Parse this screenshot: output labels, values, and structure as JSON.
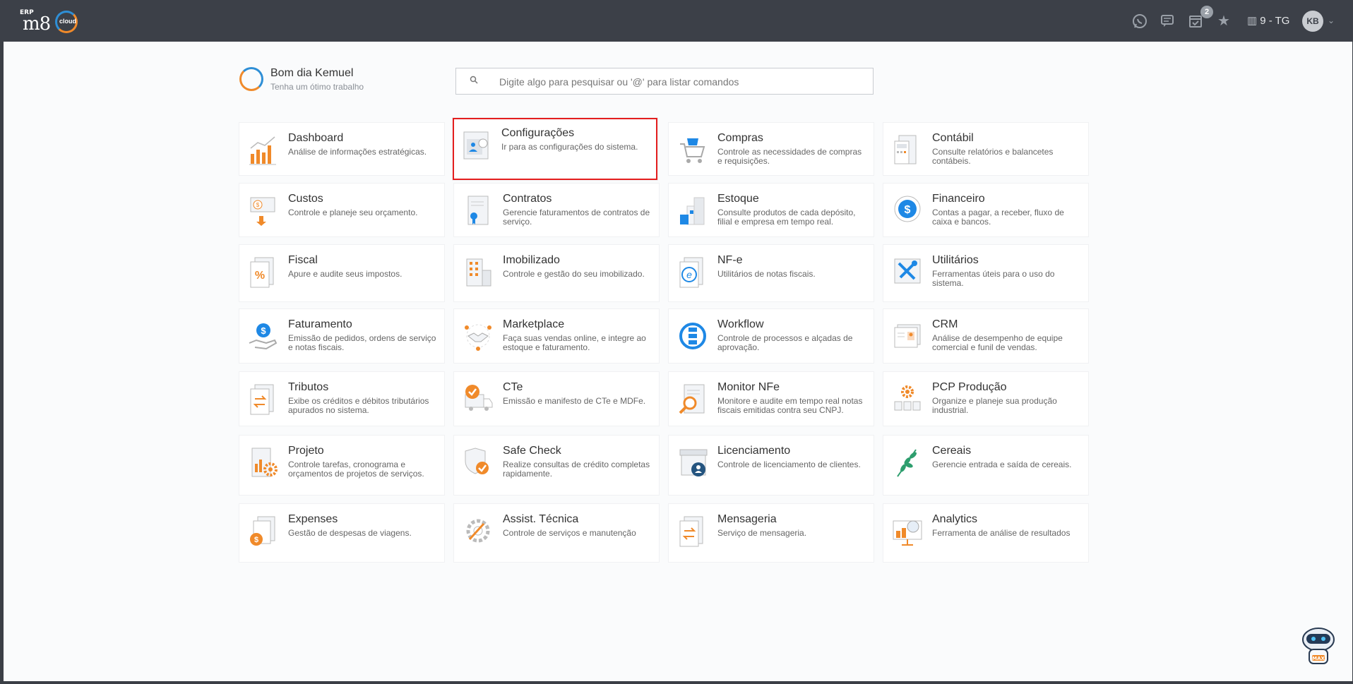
{
  "header": {
    "logo_erp": "ERP",
    "logo_m8": "m8",
    "logo_cloud": "cloud",
    "notification_count": "2",
    "company": "9 - TG",
    "avatar_initials": "KB",
    "icons": [
      "whatsapp-icon",
      "message-icon",
      "calendar-check-icon",
      "star-icon",
      "building-icon",
      "chevron-down-icon"
    ]
  },
  "greeting": {
    "title": "Bom dia Kemuel",
    "subtitle": "Tenha um ótimo trabalho"
  },
  "search": {
    "placeholder": "Digite algo para pesquisar ou '@' para listar comandos"
  },
  "modules": [
    {
      "title": "Dashboard",
      "desc": "Análise de informações estratégicas.",
      "icon": "chart-bars-icon"
    },
    {
      "title": "Configurações",
      "desc": "Ir para as configurações do sistema.",
      "icon": "settings-profile-icon",
      "selected": true
    },
    {
      "title": "Compras",
      "desc": "Controle as necessidades de compras e requisições.",
      "icon": "shopping-cart-icon"
    },
    {
      "title": "Contábil",
      "desc": "Consulte relatórios e balancetes contábeis.",
      "icon": "calculator-icon"
    },
    {
      "title": "Custos",
      "desc": "Controle e planeje seu orçamento.",
      "icon": "cost-money-icon"
    },
    {
      "title": "Contratos",
      "desc": "Gerencie faturamentos de contratos de serviço.",
      "icon": "contract-icon"
    },
    {
      "title": "Estoque",
      "desc": "Consulte produtos de cada depósito, filial e empresa em tempo real.",
      "icon": "stock-boxes-icon"
    },
    {
      "title": "Financeiro",
      "desc": "Contas a pagar, a receber, fluxo de caixa e bancos.",
      "icon": "dollar-coin-icon"
    },
    {
      "title": "Fiscal",
      "desc": "Apure e audite seus impostos.",
      "icon": "percent-document-icon"
    },
    {
      "title": "Imobilizado",
      "desc": "Controle e gestão do seu imobilizado.",
      "icon": "building-asset-icon"
    },
    {
      "title": "NF-e",
      "desc": "Utilitários de notas fiscais.",
      "icon": "electronic-invoice-icon"
    },
    {
      "title": "Utilitários",
      "desc": "Ferramentas úteis para o uso do sistema.",
      "icon": "tools-icon"
    },
    {
      "title": "Faturamento",
      "desc": "Emissão de pedidos, ordens de serviço e notas fiscais.",
      "icon": "billing-hand-icon"
    },
    {
      "title": "Marketplace",
      "desc": "Faça suas vendas online, e integre ao estoque e faturamento.",
      "icon": "handshake-icon"
    },
    {
      "title": "Workflow",
      "desc": "Controle de processos e alçadas de aprovação.",
      "icon": "workflow-icon"
    },
    {
      "title": "CRM",
      "desc": "Análise de desempenho de equipe comercial e funil de vendas.",
      "icon": "crm-card-icon"
    },
    {
      "title": "Tributos",
      "desc": "Exibe os créditos e débitos tributários apurados no sistema.",
      "icon": "tax-transfer-icon"
    },
    {
      "title": "CTe",
      "desc": "Emissão e manifesto de CTe e MDFe.",
      "icon": "truck-check-icon"
    },
    {
      "title": "Monitor NFe",
      "desc": "Monitore e audite em tempo real notas fiscais emitidas contra seu CNPJ.",
      "icon": "magnifier-document-icon"
    },
    {
      "title": "PCP Produção",
      "desc": "Organize e planeje sua produção industrial.",
      "icon": "production-gear-icon"
    },
    {
      "title": "Projeto",
      "desc": "Controle tarefas, cronograma e orçamentos de projetos de serviços.",
      "icon": "project-gear-icon"
    },
    {
      "title": "Safe Check",
      "desc": "Realize consultas de crédito completas rapidamente.",
      "icon": "shield-check-icon"
    },
    {
      "title": "Licenciamento",
      "desc": "Controle de licenciamento de clientes.",
      "icon": "license-store-icon"
    },
    {
      "title": "Cereais",
      "desc": "Gerencie entrada e saída de cereais.",
      "icon": "wheat-leaf-icon"
    },
    {
      "title": "Expenses",
      "desc": "Gestão de despesas de viagens.",
      "icon": "expense-coin-icon"
    },
    {
      "title": "Assist. Técnica",
      "desc": "Controle de serviços e manutenção",
      "icon": "gear-wrench-icon"
    },
    {
      "title": "Mensageria",
      "desc": "Serviço de mensageria.",
      "icon": "message-transfer-icon"
    },
    {
      "title": "Analytics",
      "desc": "Ferramenta de análise de resultados",
      "icon": "analytics-board-icon"
    }
  ],
  "assistant": {
    "label": "MAX",
    "icon": "robot-assistant-icon"
  },
  "colors": {
    "topbar": "#3c4048",
    "accent_orange": "#f08a2a",
    "accent_blue": "#1e88e5",
    "selection": "#e41e1e"
  }
}
